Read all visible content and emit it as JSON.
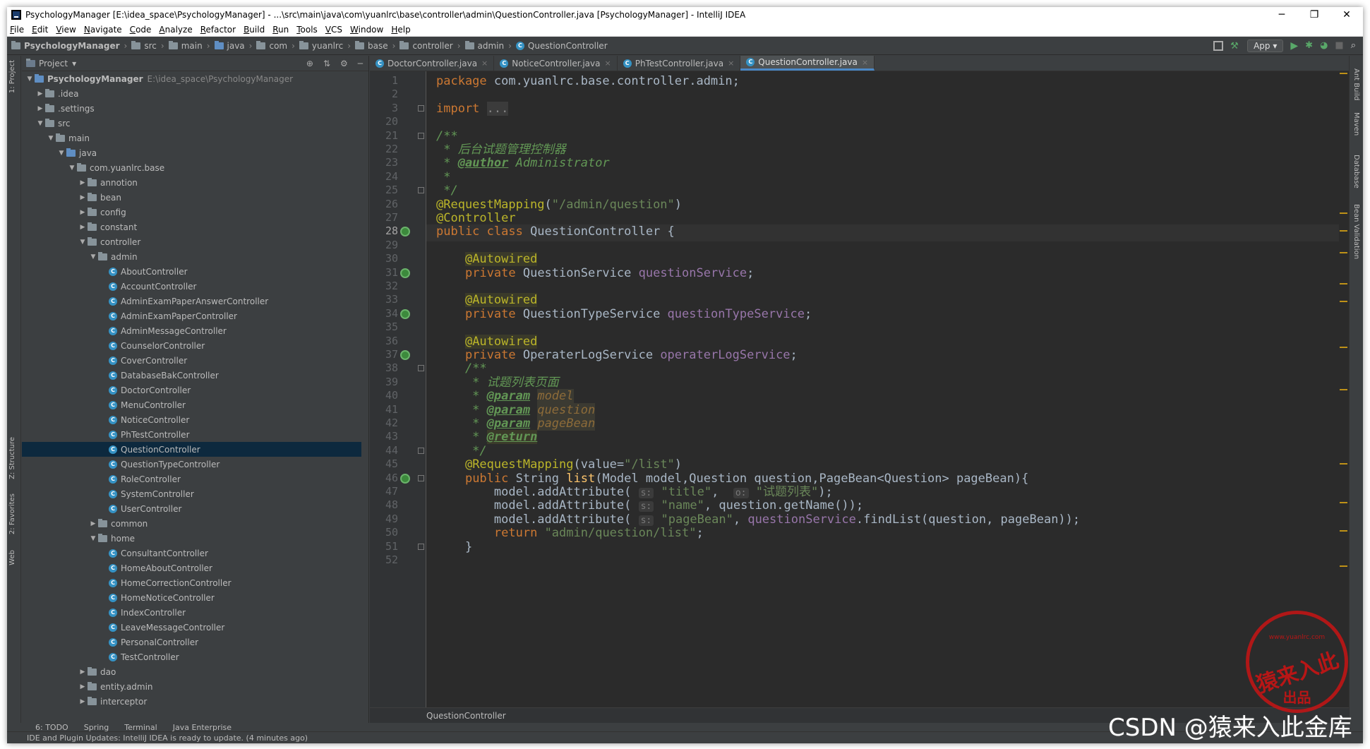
{
  "window": {
    "title": "PsychologyManager [E:\\idea_space\\PsychologyManager] - ...\\src\\main\\java\\com\\yuanlrc\\base\\controller\\admin\\QuestionController.java [PsychologyManager] - IntelliJ IDEA",
    "minimize": "─",
    "maximize": "❐",
    "close": "✕"
  },
  "menu": [
    "File",
    "Edit",
    "View",
    "Navigate",
    "Code",
    "Analyze",
    "Refactor",
    "Build",
    "Run",
    "Tools",
    "VCS",
    "Window",
    "Help"
  ],
  "breadcrumbs": [
    "PsychologyManager",
    "src",
    "main",
    "java",
    "com",
    "yuanlrc",
    "base",
    "controller",
    "admin",
    "QuestionController"
  ],
  "run_config": "App",
  "left_tabs": [
    "1: Project",
    "Z: Structure",
    "2: Favorites",
    "Web"
  ],
  "right_tabs": [
    "Ant Build",
    "Maven",
    "Database",
    "Bean Validation"
  ],
  "project_panel": {
    "title": "Project",
    "selected": "QuestionController"
  },
  "tree": [
    {
      "label": "PsychologyManager",
      "path": "E:\\idea_space\\PsychologyManager",
      "depth": 0,
      "arrow": "▼",
      "icon": "folder-blue",
      "bold": true
    },
    {
      "label": ".idea",
      "depth": 1,
      "arrow": "▶",
      "icon": "folder"
    },
    {
      "label": ".settings",
      "depth": 1,
      "arrow": "▶",
      "icon": "folder"
    },
    {
      "label": "src",
      "depth": 1,
      "arrow": "▼",
      "icon": "folder"
    },
    {
      "label": "main",
      "depth": 2,
      "arrow": "▼",
      "icon": "folder"
    },
    {
      "label": "java",
      "depth": 3,
      "arrow": "▼",
      "icon": "folder-blue"
    },
    {
      "label": "com.yuanlrc.base",
      "depth": 4,
      "arrow": "▼",
      "icon": "folder"
    },
    {
      "label": "annotion",
      "depth": 5,
      "arrow": "▶",
      "icon": "folder"
    },
    {
      "label": "bean",
      "depth": 5,
      "arrow": "▶",
      "icon": "folder"
    },
    {
      "label": "config",
      "depth": 5,
      "arrow": "▶",
      "icon": "folder"
    },
    {
      "label": "constant",
      "depth": 5,
      "arrow": "▶",
      "icon": "folder"
    },
    {
      "label": "controller",
      "depth": 5,
      "arrow": "▼",
      "icon": "folder"
    },
    {
      "label": "admin",
      "depth": 6,
      "arrow": "▼",
      "icon": "folder"
    },
    {
      "label": "AboutController",
      "depth": 7,
      "icon": "class"
    },
    {
      "label": "AccountController",
      "depth": 7,
      "icon": "class"
    },
    {
      "label": "AdminExamPaperAnswerController",
      "depth": 7,
      "icon": "class"
    },
    {
      "label": "AdminExamPaperController",
      "depth": 7,
      "icon": "class"
    },
    {
      "label": "AdminMessageController",
      "depth": 7,
      "icon": "class"
    },
    {
      "label": "CounselorController",
      "depth": 7,
      "icon": "class"
    },
    {
      "label": "CoverController",
      "depth": 7,
      "icon": "class"
    },
    {
      "label": "DatabaseBakController",
      "depth": 7,
      "icon": "class"
    },
    {
      "label": "DoctorController",
      "depth": 7,
      "icon": "class"
    },
    {
      "label": "MenuController",
      "depth": 7,
      "icon": "class"
    },
    {
      "label": "NoticeController",
      "depth": 7,
      "icon": "class"
    },
    {
      "label": "PhTestController",
      "depth": 7,
      "icon": "class"
    },
    {
      "label": "QuestionController",
      "depth": 7,
      "icon": "class",
      "selected": true
    },
    {
      "label": "QuestionTypeController",
      "depth": 7,
      "icon": "class"
    },
    {
      "label": "RoleController",
      "depth": 7,
      "icon": "class"
    },
    {
      "label": "SystemController",
      "depth": 7,
      "icon": "class"
    },
    {
      "label": "UserController",
      "depth": 7,
      "icon": "class"
    },
    {
      "label": "common",
      "depth": 6,
      "arrow": "▶",
      "icon": "folder"
    },
    {
      "label": "home",
      "depth": 6,
      "arrow": "▼",
      "icon": "folder"
    },
    {
      "label": "ConsultantController",
      "depth": 7,
      "icon": "class"
    },
    {
      "label": "HomeAboutController",
      "depth": 7,
      "icon": "class"
    },
    {
      "label": "HomeCorrectionController",
      "depth": 7,
      "icon": "class"
    },
    {
      "label": "HomeNoticeController",
      "depth": 7,
      "icon": "class"
    },
    {
      "label": "IndexController",
      "depth": 7,
      "icon": "class"
    },
    {
      "label": "LeaveMessageController",
      "depth": 7,
      "icon": "class"
    },
    {
      "label": "PersonalController",
      "depth": 7,
      "icon": "class"
    },
    {
      "label": "TestController",
      "depth": 7,
      "icon": "class"
    },
    {
      "label": "dao",
      "depth": 5,
      "arrow": "▶",
      "icon": "folder"
    },
    {
      "label": "entity.admin",
      "depth": 5,
      "arrow": "▶",
      "icon": "folder"
    },
    {
      "label": "interceptor",
      "depth": 5,
      "arrow": "▶",
      "icon": "folder"
    }
  ],
  "editor_tabs": [
    {
      "label": "DoctorController.java",
      "active": false
    },
    {
      "label": "NoticeController.java",
      "active": false
    },
    {
      "label": "PhTestController.java",
      "active": false
    },
    {
      "label": "QuestionController.java",
      "active": true
    }
  ],
  "code_lines": [
    {
      "n": "1",
      "html": "<span class='kw'>package</span> com.yuanlrc.base.controller.admin;"
    },
    {
      "n": "2",
      "html": ""
    },
    {
      "n": "3",
      "html": "<span class='kw'>import</span> <span class='fo'>...</span>",
      "fold": true
    },
    {
      "n": "20",
      "html": ""
    },
    {
      "n": "21",
      "html": "<span class='cm'>/**</span>",
      "fold": true
    },
    {
      "n": "22",
      "html": "<span class='cm'> * 后台试题管理控制器</span>"
    },
    {
      "n": "23",
      "html": "<span class='cm'> * </span><span class='tg'>@author</span><span class='cm'> Administrator</span>"
    },
    {
      "n": "24",
      "html": "<span class='cm'> *</span>"
    },
    {
      "n": "25",
      "html": "<span class='cm'> */</span>",
      "fold": true
    },
    {
      "n": "26",
      "html": "<span class='an'>@RequestMapping</span>(<span class='st'>\"/admin/question\"</span>)"
    },
    {
      "n": "27",
      "html": "<span class='an'>@Controller</span>"
    },
    {
      "n": "28",
      "html": "<span class='kw'>public class</span> QuestionController {",
      "gicon": true,
      "cursor": true
    },
    {
      "n": "29",
      "html": ""
    },
    {
      "n": "30",
      "html": "    <span class='an rp'>@Autowired</span>"
    },
    {
      "n": "31",
      "html": "    <span class='kw'>private</span> QuestionService <span class='fd'>questionService</span>;",
      "gicon": true
    },
    {
      "n": "32",
      "html": ""
    },
    {
      "n": "33",
      "html": "    <span class='an rp'>@Autowired</span>"
    },
    {
      "n": "34",
      "html": "    <span class='kw'>private</span> QuestionTypeService <span class='fd'>questionTypeService</span>;",
      "gicon": true
    },
    {
      "n": "35",
      "html": ""
    },
    {
      "n": "36",
      "html": "    <span class='an rp'>@Autowired</span>"
    },
    {
      "n": "37",
      "html": "    <span class='kw'>private</span> OperaterLogService <span class='fd'>operaterLogService</span>;",
      "gicon": true
    },
    {
      "n": "38",
      "html": "    <span class='cm'>/**</span>",
      "fold": true
    },
    {
      "n": "39",
      "html": "<span class='cm'>     * 试题列表页面</span>"
    },
    {
      "n": "40",
      "html": "<span class='cm'>     * </span><span class='tg'>@param</span> <span class='pp'>model</span>"
    },
    {
      "n": "41",
      "html": "<span class='cm'>     * </span><span class='tg'>@param</span> <span class='pp'>question</span>"
    },
    {
      "n": "42",
      "html": "<span class='cm'>     * </span><span class='tg'>@param</span> <span class='pp'>pageBean</span>"
    },
    {
      "n": "43",
      "html": "<span class='cm'>     * </span><span class='tg' style='background:#3a3a2a'>@return</span>"
    },
    {
      "n": "44",
      "html": "<span class='cm'>     */</span>",
      "fold": true
    },
    {
      "n": "45",
      "html": "    <span class='an'>@RequestMapping</span>(value=<span class='st'>\"/list\"</span>)"
    },
    {
      "n": "46",
      "html": "    <span class='kw'>public</span> String <span class='mt'>list</span>(Model model,Question question,PageBean&lt;Question&gt; pageBean){",
      "gicon": true,
      "fold": true
    },
    {
      "n": "47",
      "html": "        model.addAttribute( <span class='hint'>s:</span> <span class='st'>\"title\"</span>,  <span class='hint'>o:</span> <span class='st'>\"试题列表\"</span>);"
    },
    {
      "n": "48",
      "html": "        model.addAttribute( <span class='hint'>s:</span> <span class='st'>\"name\"</span>, question.getName());"
    },
    {
      "n": "49",
      "html": "        model.addAttribute( <span class='hint'>s:</span> <span class='st'>\"pageBean\"</span>, <span class='fd'>questionService</span>.findList(question, pageBean));"
    },
    {
      "n": "50",
      "html": "        <span class='kw'>return</span> <span class='st'>\"admin/question/list\"</span>;"
    },
    {
      "n": "51",
      "html": "    }",
      "fold": true
    },
    {
      "n": "52",
      "html": ""
    }
  ],
  "editor_breadcrumb": "QuestionController",
  "bottom_tools": [
    "6: TODO",
    "Spring",
    "Terminal",
    "Java Enterprise"
  ],
  "status": "IDE and Plugin Updates: IntelliJ IDEA is ready to update. (4 minutes ago)",
  "stamp": {
    "top": "www.yuanlrc.com",
    "main": "猿来入此",
    "sub": "出品"
  },
  "watermark": "CSDN @猿来入此金库"
}
